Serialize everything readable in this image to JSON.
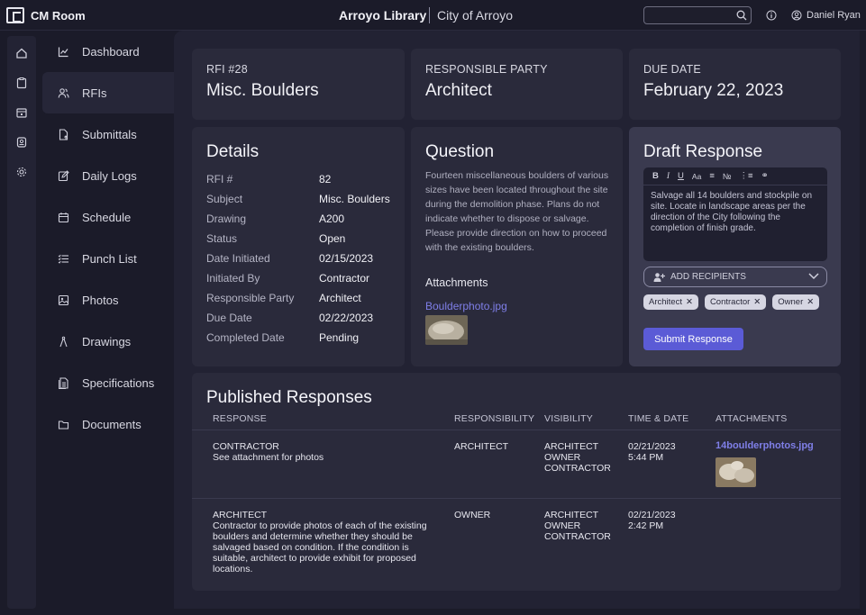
{
  "header": {
    "app_name": "CM Room",
    "project": "Arroyo Library",
    "client": "City of Arroyo",
    "search_placeholder": "",
    "user_name": "Daniel Ryan"
  },
  "sidebar": {
    "items": [
      {
        "label": "Dashboard",
        "icon": "chart-icon"
      },
      {
        "label": "RFIs",
        "icon": "users-icon"
      },
      {
        "label": "Submittals",
        "icon": "file-upload-icon"
      },
      {
        "label": "Daily Logs",
        "icon": "edit-icon"
      },
      {
        "label": "Schedule",
        "icon": "calendar-icon"
      },
      {
        "label": "Punch List",
        "icon": "list-icon"
      },
      {
        "label": "Photos",
        "icon": "image-icon"
      },
      {
        "label": "Drawings",
        "icon": "compass-icon"
      },
      {
        "label": "Specifications",
        "icon": "document-icon"
      },
      {
        "label": "Documents",
        "icon": "folder-icon"
      }
    ]
  },
  "summary": {
    "rfi_label": "RFI #28",
    "rfi_title": "Misc. Boulders",
    "party_label": "RESPONSIBLE PARTY",
    "party_value": "Architect",
    "due_label": "DUE DATE",
    "due_value": "February 22, 2023"
  },
  "details": {
    "title": "Details",
    "rows": [
      {
        "label": "RFI #",
        "value": "82"
      },
      {
        "label": "Subject",
        "value": "Misc. Boulders"
      },
      {
        "label": "Drawing",
        "value": "A200"
      },
      {
        "label": "Status",
        "value": "Open"
      },
      {
        "label": "Date Initiated",
        "value": "02/15/2023"
      },
      {
        "label": "Initiated By",
        "value": "Contractor"
      },
      {
        "label": "Responsible Party",
        "value": "Architect"
      },
      {
        "label": "Due Date",
        "value": "02/22/2023"
      },
      {
        "label": "Completed Date",
        "value": "Pending"
      }
    ]
  },
  "question": {
    "title": "Question",
    "text": "Fourteen miscellaneous boulders of various sizes have been located throughout the site during the demolition phase. Plans do not indicate whether to dispose or salvage. Please provide direction on how to proceed with the existing boulders.",
    "attachments_label": "Attachments",
    "attachment_name": "Boulderphoto.jpg"
  },
  "draft": {
    "title": "Draft Response",
    "text": "Salvage all 14 boulders and stockpile on site. Locate in landscape areas per the direction of the City following the completion of finish grade.",
    "add_recipients": "ADD RECIPIENTS",
    "recipients": [
      "Architect",
      "Contractor",
      "Owner"
    ],
    "submit_label": "Submit Response"
  },
  "published": {
    "title": "Published Responses",
    "headers": [
      "RESPONSE",
      "RESPONSIBILITY",
      "VISIBILITY",
      "TIME & DATE",
      "ATTACHMENTS"
    ],
    "rows": [
      {
        "author": "CONTRACTOR",
        "text": "See attachment for photos",
        "responsibility": "ARCHITECT",
        "visibility": [
          "ARCHITECT",
          "OWNER",
          "CONTRACTOR"
        ],
        "date": "02/21/2023",
        "time": "5:44 PM",
        "attachment": "14boulderphotos.jpg"
      },
      {
        "author": "ARCHITECT",
        "text": "Contractor to provide photos of each of the existing boulders and determine whether they should be salvaged based on condition. If the condition is suitable, architect to provide exhibit for proposed locations.",
        "responsibility": "OWNER",
        "visibility": [
          "ARCHITECT",
          "OWNER",
          "CONTRACTOR"
        ],
        "date": "02/21/2023",
        "time": "2:42 PM",
        "attachment": ""
      }
    ]
  },
  "colors": {
    "background": "#1b1b29",
    "card": "#2a2a3b",
    "accent": "#5b5bd6",
    "link": "#7f7fe8"
  }
}
